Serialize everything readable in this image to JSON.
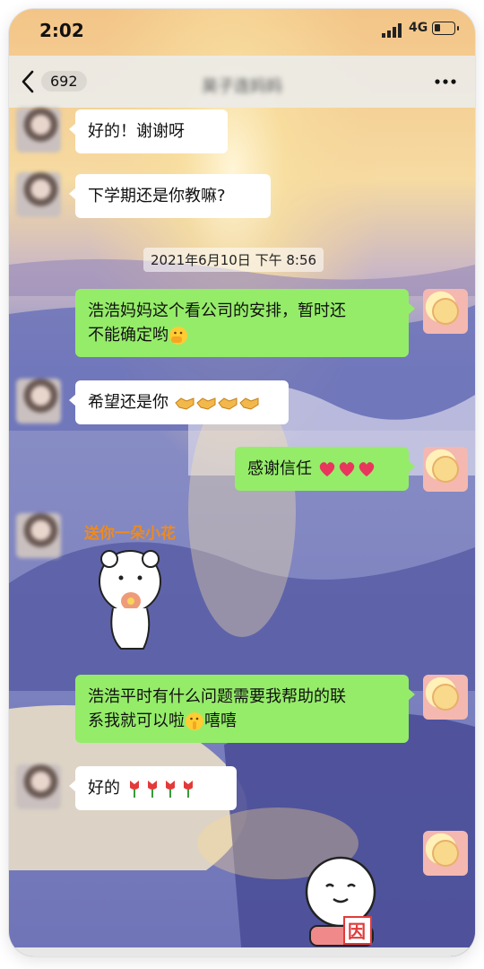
{
  "status_bar": {
    "time": "2:02",
    "network": "4G",
    "battery_level": 0.3
  },
  "nav": {
    "unread_count": "692",
    "chat_title": "昊子连妈妈",
    "back_icon": "chevron-left-icon",
    "more_icon": "more-dots-icon"
  },
  "timestamp": "2021年6月10日 下午 8:56",
  "messages": [
    {
      "from": "them",
      "text": "好的！谢谢呀"
    },
    {
      "from": "them",
      "text": "下学期还是你教嘛?"
    },
    {
      "from": "me",
      "line1": "浩浩妈妈这个看公司的安排，暂时还",
      "line2": "不能确定哟",
      "emoji": "hand-over-mouth-emoji"
    },
    {
      "from": "them",
      "text": "希望还是你",
      "emoji": "handshake-emoji",
      "emoji_count": 4
    },
    {
      "from": "me",
      "text": "感谢信任",
      "emoji": "red-heart-emoji",
      "emoji_count": 3
    },
    {
      "from": "them",
      "sticker": "bear-flower-sticker",
      "sticker_text": "送你一朵小花"
    },
    {
      "from": "me",
      "line1": "浩浩平时有什么问题需要我帮助的联",
      "line2_a": "系我就可以啦",
      "line2_b": "嘻嘻",
      "emoji": "shushing-face-emoji"
    },
    {
      "from": "them",
      "text": "好的",
      "emoji": "tulip-emoji",
      "emoji_count": 4
    },
    {
      "from": "me",
      "sticker": "white-face-sticker",
      "sticker_text": "因"
    }
  ]
}
